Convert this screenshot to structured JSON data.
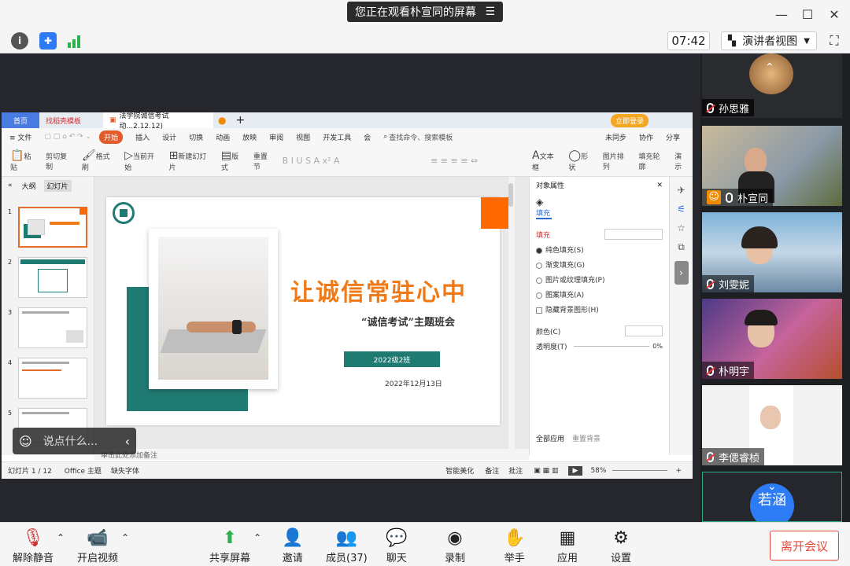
{
  "banner": {
    "text": "您正在观看朴宣同的屏幕",
    "menu_icon": "list-icon"
  },
  "window": {
    "minimize": "—",
    "maximize": "☐",
    "close": "✕"
  },
  "toolbar": {
    "time": "07:42",
    "presenter_view": "演讲者视图"
  },
  "wps": {
    "tabs": [
      "首页",
      "找稻壳模板",
      "法学院诚信考试动...2.12.12)"
    ],
    "login": "立即登录",
    "menu": [
      "≡ 文件",
      "开始",
      "插入",
      "设计",
      "切换",
      "动画",
      "放映",
      "审阅",
      "视图",
      "开发工具",
      "会"
    ],
    "search": "查找命令、搜索模板",
    "sync": "未同步",
    "collab": "协作",
    "share": "分享",
    "ribbon": [
      "粘贴",
      "剪切",
      "复制",
      "格式刷",
      "当前开始",
      "新建幻灯片",
      "版式",
      "节",
      "重置",
      "文本框",
      "形状",
      "排列",
      "图片",
      "填充",
      "轮廓",
      "演示"
    ],
    "panel_tabs": [
      "大纲",
      "幻灯片"
    ],
    "thumb_nums": [
      "1",
      "2",
      "3",
      "4",
      "5"
    ],
    "slide": {
      "title": "让诚信常驻心中",
      "subtitle": "“诚信考试”主题班会",
      "class": "2022级2班",
      "date": "2022年12月13日"
    },
    "props": {
      "header": "对象属性",
      "tab": "填充",
      "section": "填充",
      "options": [
        "纯色填充(S)",
        "渐变填充(G)",
        "图片或纹理填充(P)",
        "图案填充(A)",
        "隐藏背景图形(H)"
      ],
      "color": "颜色(C)",
      "transparency": "透明度(T)",
      "trans_value": "0%",
      "apply_all": "全部应用",
      "reset_bg": "重置背景"
    },
    "notes": "单击此处添加备注",
    "status": {
      "slide_num": "幻灯片 1 / 12",
      "theme": "Office 主题",
      "font_missing": "缺失字体",
      "beautify": "智能美化",
      "notes": "备注",
      "comment": "批注",
      "zoom": "58%"
    }
  },
  "chat_bubble": {
    "placeholder": "说点什么..."
  },
  "participants": [
    {
      "name": "孙思雅"
    },
    {
      "name": "朴宣同"
    },
    {
      "name": "刘雯妮"
    },
    {
      "name": "朴明宇"
    },
    {
      "name": "李偲睿桢"
    },
    {
      "name": "若涵"
    }
  ],
  "bottom": {
    "unmute": "解除静音",
    "video": "开启视频",
    "share": "共享屏幕",
    "invite": "邀请",
    "members": "成员(37)",
    "chat": "聊天",
    "record": "录制",
    "hand": "举手",
    "apps": "应用",
    "settings": "设置",
    "leave": "离开会议"
  },
  "colors": {
    "accent": "#ff6a00",
    "teal": "#1f7a72",
    "leave": "#e5483a",
    "title": "#f07a17"
  }
}
